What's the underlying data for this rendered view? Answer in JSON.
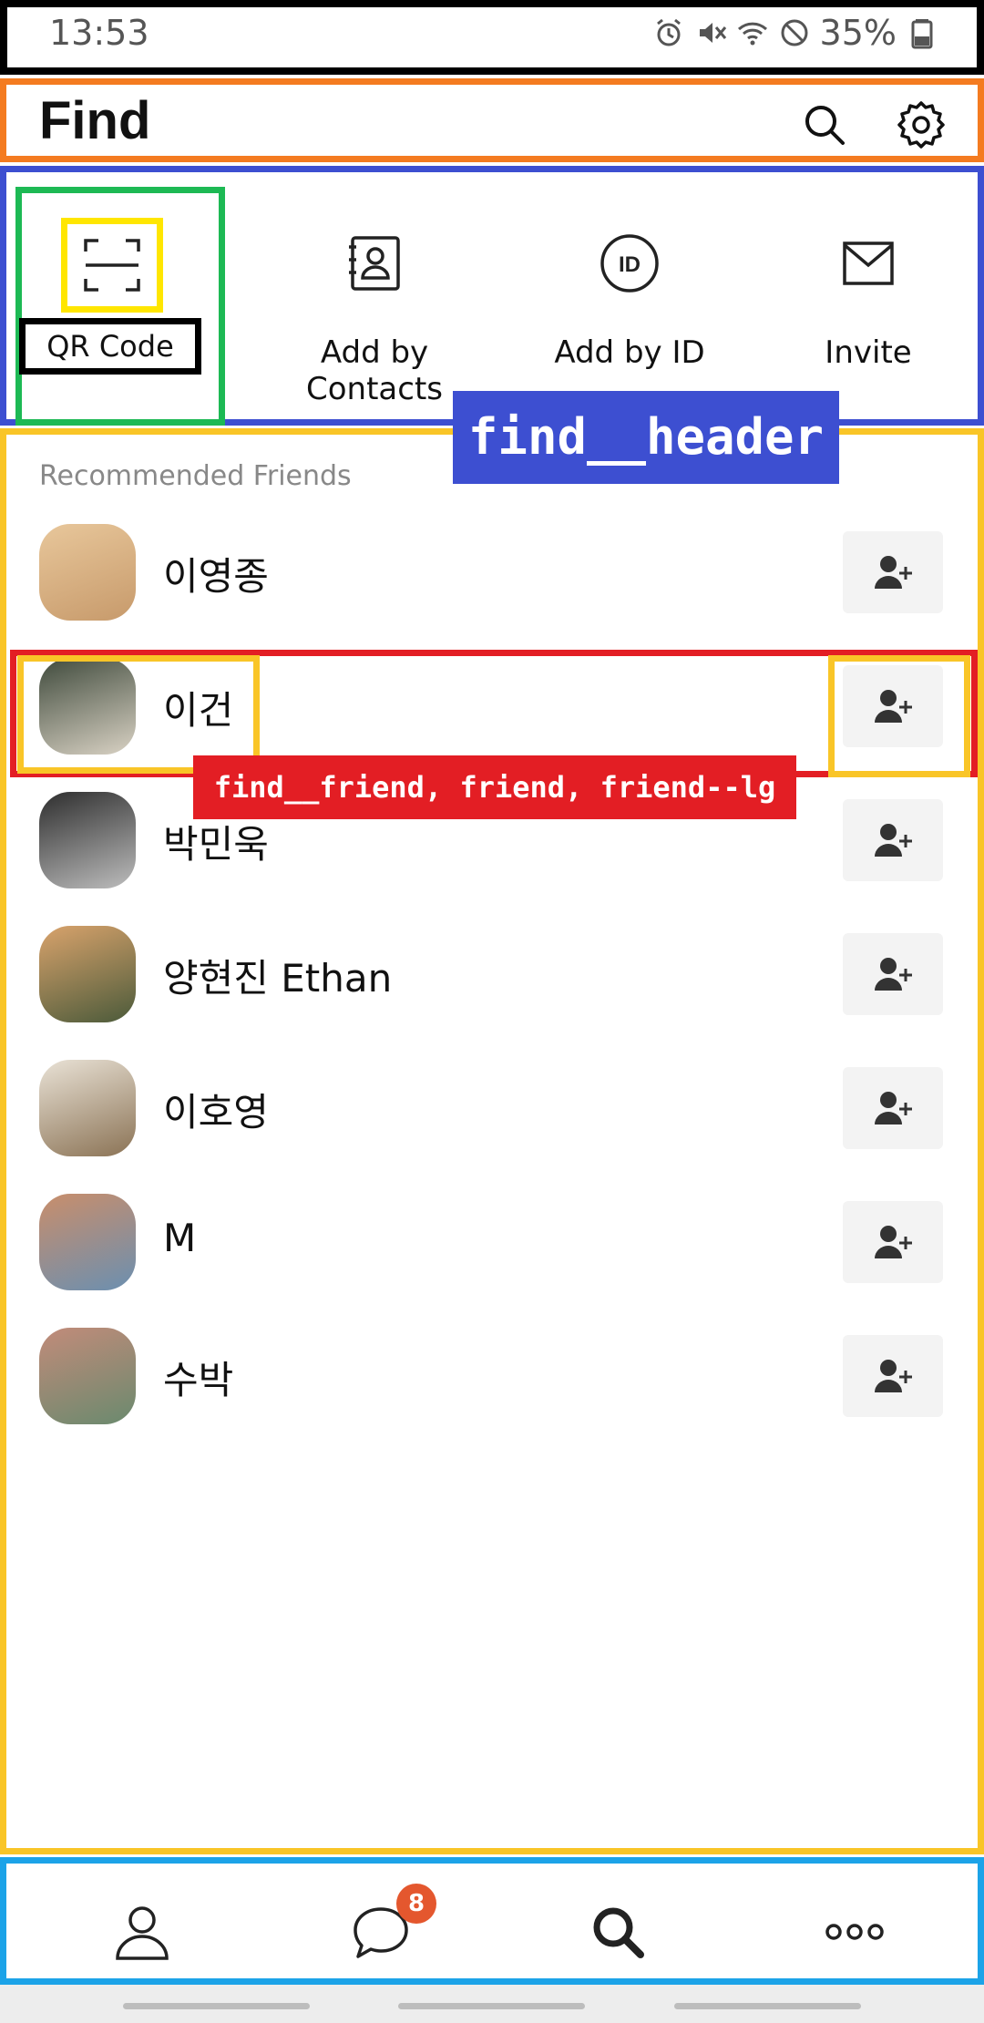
{
  "status_bar": {
    "time": "13:53",
    "battery": "35%",
    "icons": [
      "alarm-icon",
      "mute-icon",
      "wifi-icon",
      "no-disturb-icon",
      "battery-icon"
    ]
  },
  "title_bar": {
    "title": "Find",
    "icons": [
      "search-icon",
      "settings-gear-icon"
    ]
  },
  "find_header": {
    "tag_label": "find__header",
    "actions": [
      {
        "label": "QR Code",
        "icon": "qr-scan-icon"
      },
      {
        "label": "Add by Contacts",
        "icon": "contacts-book-icon"
      },
      {
        "label": "Add by ID",
        "icon": "id-circle-icon"
      },
      {
        "label": "Invite",
        "icon": "envelope-icon"
      }
    ]
  },
  "recommended": {
    "title": "Recommended Friends",
    "highlight_tag": "find__friend, friend, friend--lg",
    "friends": [
      {
        "name": "이영종",
        "avatar_colors": [
          "#E8C79B",
          "#C79A6B"
        ]
      },
      {
        "name": "이건",
        "avatar_colors": [
          "#3F4A3C",
          "#D9D2C4"
        ]
      },
      {
        "name": "박민욱",
        "avatar_colors": [
          "#2E2E2E",
          "#BDBDBD"
        ]
      },
      {
        "name": "양현진 Ethan",
        "avatar_colors": [
          "#D9A36C",
          "#4B5A3A"
        ]
      },
      {
        "name": "이호영",
        "avatar_colors": [
          "#E9E2D6",
          "#8B7355"
        ]
      },
      {
        "name": "M",
        "avatar_colors": [
          "#C98E6B",
          "#6B8FB0"
        ]
      },
      {
        "name": "수박",
        "avatar_colors": [
          "#C28B7A",
          "#6A8A6E"
        ]
      }
    ]
  },
  "bottom_nav": {
    "items": [
      {
        "name": "friends",
        "icon": "person-icon"
      },
      {
        "name": "chats",
        "icon": "chat-bubble-icon",
        "badge": "8"
      },
      {
        "name": "find",
        "icon": "search-icon"
      },
      {
        "name": "more",
        "icon": "more-dots-icon"
      }
    ]
  },
  "colors": {
    "accent_orange": "#F47B20",
    "accent_blue": "#3D4FD1",
    "accent_red": "#E31E24",
    "accent_yellow": "#F9C527",
    "accent_green": "#1DB954",
    "nav_border_blue": "#1CA3E8",
    "badge_orange": "#E4572E"
  }
}
